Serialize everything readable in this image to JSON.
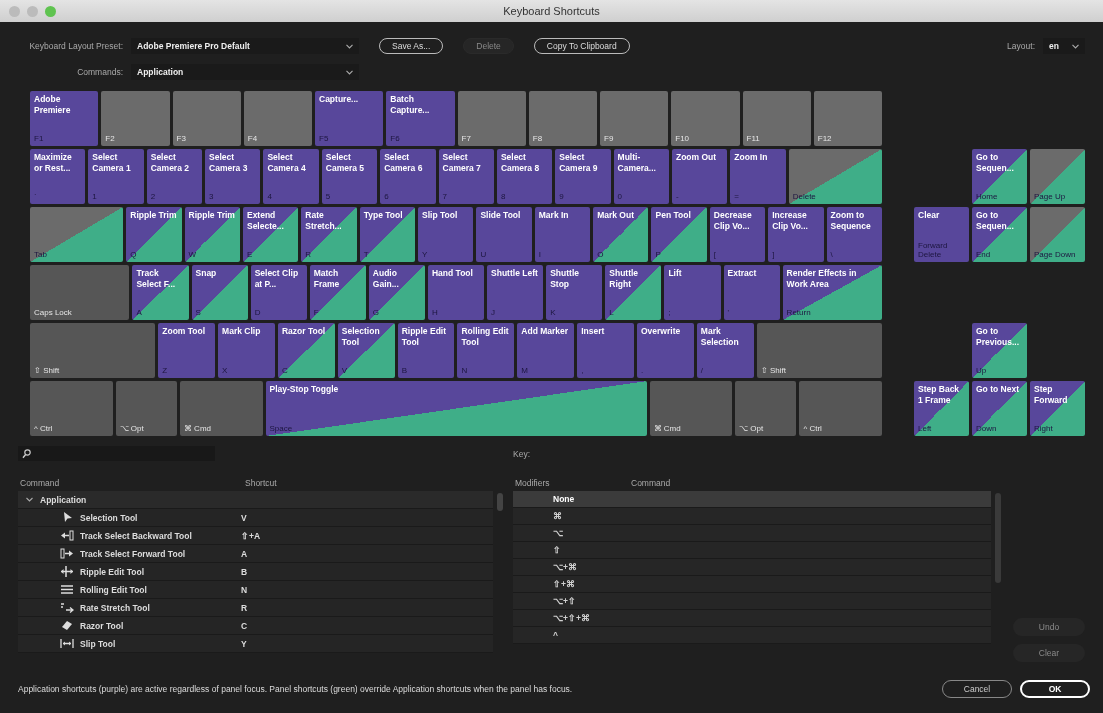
{
  "window": {
    "title": "Keyboard Shortcuts"
  },
  "toolbar": {
    "preset_label": "Keyboard Layout Preset:",
    "preset": "Adobe Premiere Pro Default",
    "commands_label": "Commands:",
    "commands": "Application",
    "layout_label": "Layout:",
    "layout": "en",
    "buttons": [
      {
        "label": "Save As...",
        "disabled": false
      },
      {
        "label": "Delete",
        "disabled": true
      },
      {
        "label": "Copy To Clipboard",
        "disabled": false
      }
    ]
  },
  "keyboard": {
    "rows": [
      {
        "keys": [
          {
            "kind": "app",
            "label": "Adobe Premiere",
            "legend": "F1"
          },
          {
            "kind": "none",
            "legend": "F2"
          },
          {
            "kind": "none",
            "legend": "F3"
          },
          {
            "kind": "none",
            "legend": "F4"
          },
          {
            "kind": "app",
            "label": "Capture...",
            "legend": "F5"
          },
          {
            "kind": "app",
            "label": "Batch Capture...",
            "legend": "F6"
          },
          {
            "kind": "none",
            "legend": "F7"
          },
          {
            "kind": "none",
            "legend": "F8"
          },
          {
            "kind": "none",
            "legend": "F9"
          },
          {
            "kind": "none",
            "legend": "F10"
          },
          {
            "kind": "none",
            "legend": "F11"
          },
          {
            "kind": "none",
            "legend": "F12"
          }
        ]
      },
      {
        "keys": [
          {
            "kind": "app",
            "label": "Maximize or Rest...",
            "legend": "`"
          },
          {
            "kind": "app",
            "label": "Select Camera 1",
            "legend": "1"
          },
          {
            "kind": "app",
            "label": "Select Camera 2",
            "legend": "2"
          },
          {
            "kind": "app",
            "label": "Select Camera 3",
            "legend": "3"
          },
          {
            "kind": "app",
            "label": "Select Camera 4",
            "legend": "4"
          },
          {
            "kind": "app",
            "label": "Select Camera 5",
            "legend": "5"
          },
          {
            "kind": "app",
            "label": "Select Camera 6",
            "legend": "6"
          },
          {
            "kind": "app",
            "label": "Select Camera 7",
            "legend": "7"
          },
          {
            "kind": "app",
            "label": "Select Camera 8",
            "legend": "8"
          },
          {
            "kind": "app",
            "label": "Select Camera 9",
            "legend": "9"
          },
          {
            "kind": "app",
            "label": "Multi-Camera...",
            "legend": "0"
          },
          {
            "kind": "app",
            "label": "Zoom Out",
            "legend": "-"
          },
          {
            "kind": "app",
            "label": "Zoom In",
            "legend": "="
          },
          {
            "kind": "panel",
            "legend": "Delete"
          }
        ]
      },
      {
        "keys": [
          {
            "kind": "panel",
            "legend": "Tab"
          },
          {
            "kind": "both",
            "label": "Ripple Trim",
            "legend": "Q"
          },
          {
            "kind": "both",
            "label": "Ripple Trim",
            "legend": "W"
          },
          {
            "kind": "both",
            "label": "Extend Selecte...",
            "legend": "E"
          },
          {
            "kind": "both",
            "label": "Rate Stretch...",
            "legend": "R"
          },
          {
            "kind": "both",
            "label": "Type Tool",
            "legend": "T"
          },
          {
            "kind": "app",
            "label": "Slip Tool",
            "legend": "Y"
          },
          {
            "kind": "app",
            "label": "Slide Tool",
            "legend": "U"
          },
          {
            "kind": "app",
            "label": "Mark In",
            "legend": "I"
          },
          {
            "kind": "both",
            "label": "Mark Out",
            "legend": "O"
          },
          {
            "kind": "both",
            "label": "Pen Tool",
            "legend": "P"
          },
          {
            "kind": "app",
            "label": "Decrease Clip Vo...",
            "legend": "["
          },
          {
            "kind": "app",
            "label": "Increase Clip Vo...",
            "legend": "]"
          },
          {
            "kind": "app",
            "label": "Zoom to Sequence",
            "legend": "\\"
          }
        ]
      },
      {
        "keys": [
          {
            "kind": "none",
            "legend": "Caps Lock"
          },
          {
            "kind": "both",
            "label": "Track Select F...",
            "legend": "A"
          },
          {
            "kind": "both",
            "label": "Snap",
            "legend": "S"
          },
          {
            "kind": "app",
            "label": "Select Clip at P...",
            "legend": "D"
          },
          {
            "kind": "both",
            "label": "Match Frame",
            "legend": "F"
          },
          {
            "kind": "both",
            "label": "Audio Gain...",
            "legend": "G"
          },
          {
            "kind": "app",
            "label": "Hand Tool",
            "legend": "H"
          },
          {
            "kind": "app",
            "label": "Shuttle Left",
            "legend": "J"
          },
          {
            "kind": "app",
            "label": "Shuttle Stop",
            "legend": "K"
          },
          {
            "kind": "both",
            "label": "Shuttle Right",
            "legend": "L"
          },
          {
            "kind": "app",
            "label": "Lift",
            "legend": ";"
          },
          {
            "kind": "app",
            "label": "Extract",
            "legend": "'"
          },
          {
            "kind": "both",
            "label": "Render Effects in Work Area",
            "legend": "Return"
          }
        ]
      },
      {
        "keys": [
          {
            "kind": "none",
            "legend": "⇧ Shift"
          },
          {
            "kind": "app",
            "label": "Zoom Tool",
            "legend": "Z"
          },
          {
            "kind": "app",
            "label": "Mark Clip",
            "legend": "X"
          },
          {
            "kind": "both",
            "label": "Razor Tool",
            "legend": "C"
          },
          {
            "kind": "both",
            "label": "Selection Tool",
            "legend": "V"
          },
          {
            "kind": "app",
            "label": "Ripple Edit Tool",
            "legend": "B"
          },
          {
            "kind": "app",
            "label": "Rolling Edit Tool",
            "legend": "N"
          },
          {
            "kind": "app",
            "label": "Add Marker",
            "legend": "M"
          },
          {
            "kind": "app",
            "label": "Insert",
            "legend": ","
          },
          {
            "kind": "app",
            "label": "Overwrite",
            "legend": "."
          },
          {
            "kind": "app",
            "label": "Mark Selection",
            "legend": "/"
          },
          {
            "kind": "none",
            "legend": "⇧ Shift"
          }
        ]
      },
      {
        "keys": [
          {
            "kind": "none",
            "legend": "^ Ctrl"
          },
          {
            "kind": "none",
            "legend": "⌥ Opt"
          },
          {
            "kind": "none",
            "legend": "⌘ Cmd"
          },
          {
            "kind": "both",
            "label": "Play-Stop Toggle",
            "legend": "Space"
          },
          {
            "kind": "none",
            "legend": "⌘ Cmd"
          },
          {
            "kind": "none",
            "legend": "⌥ Opt"
          },
          {
            "kind": "none",
            "legend": "^ Ctrl"
          }
        ]
      }
    ],
    "nav": [
      {
        "kind": "both",
        "label": "Go to Sequen...",
        "legend": "Home"
      },
      {
        "kind": "panel",
        "legend": "Page Up"
      },
      {
        "kind": "app",
        "label": "Clear",
        "legend": "Forward Delete"
      },
      {
        "kind": "both",
        "label": "Go to Sequen...",
        "legend": "End"
      },
      {
        "kind": "panel",
        "legend": "Page Down"
      },
      {
        "kind": "both",
        "label": "Go to Previous...",
        "legend": "Up"
      },
      {
        "kind": "both",
        "label": "Step Back 1 Frame",
        "legend": "Left"
      },
      {
        "kind": "both",
        "label": "Go to Next",
        "legend": "Down"
      },
      {
        "kind": "both",
        "label": "Step Forward",
        "legend": "Right"
      }
    ]
  },
  "key_label": "Key:",
  "commands_table": {
    "columns": [
      "Command",
      "Shortcut"
    ],
    "tree": [
      {
        "label": "Application",
        "expanded": true,
        "children": [
          {
            "label": "Selection Tool",
            "shortcut": "V"
          },
          {
            "label": "Track Select Backward Tool",
            "shortcut": "⇧+A"
          },
          {
            "label": "Track Select Forward Tool",
            "shortcut": "A"
          },
          {
            "label": "Ripple Edit Tool",
            "shortcut": "B"
          },
          {
            "label": "Rolling Edit Tool",
            "shortcut": "N"
          },
          {
            "label": "Rate Stretch Tool",
            "shortcut": "R"
          },
          {
            "label": "Razor Tool",
            "shortcut": "C"
          },
          {
            "label": "Slip Tool",
            "shortcut": "Y"
          }
        ]
      }
    ]
  },
  "modifiers_table": {
    "columns": [
      "Modifiers",
      "Command"
    ],
    "rows": [
      {
        "modifiers": "None",
        "selected": true
      },
      {
        "modifiers": "⌘",
        "selected": false
      },
      {
        "modifiers": "⌥",
        "selected": false
      },
      {
        "modifiers": "⇧",
        "selected": false
      },
      {
        "modifiers": "⌥+⌘",
        "selected": false
      },
      {
        "modifiers": "⇧+⌘",
        "selected": false
      },
      {
        "modifiers": "⌥+⇧",
        "selected": false
      },
      {
        "modifiers": "⌥+⇧+⌘",
        "selected": false
      },
      {
        "modifiers": "^",
        "selected": false
      }
    ]
  },
  "side_buttons": [
    {
      "label": "Undo",
      "disabled": true
    },
    {
      "label": "Clear",
      "disabled": true
    }
  ],
  "footer": {
    "note": "Application shortcuts (purple) are active regardless of panel focus. Panel shortcuts (green) override Application shortcuts when the panel has focus.",
    "buttons": [
      {
        "label": "Cancel",
        "default": false
      },
      {
        "label": "OK",
        "default": true
      }
    ]
  }
}
